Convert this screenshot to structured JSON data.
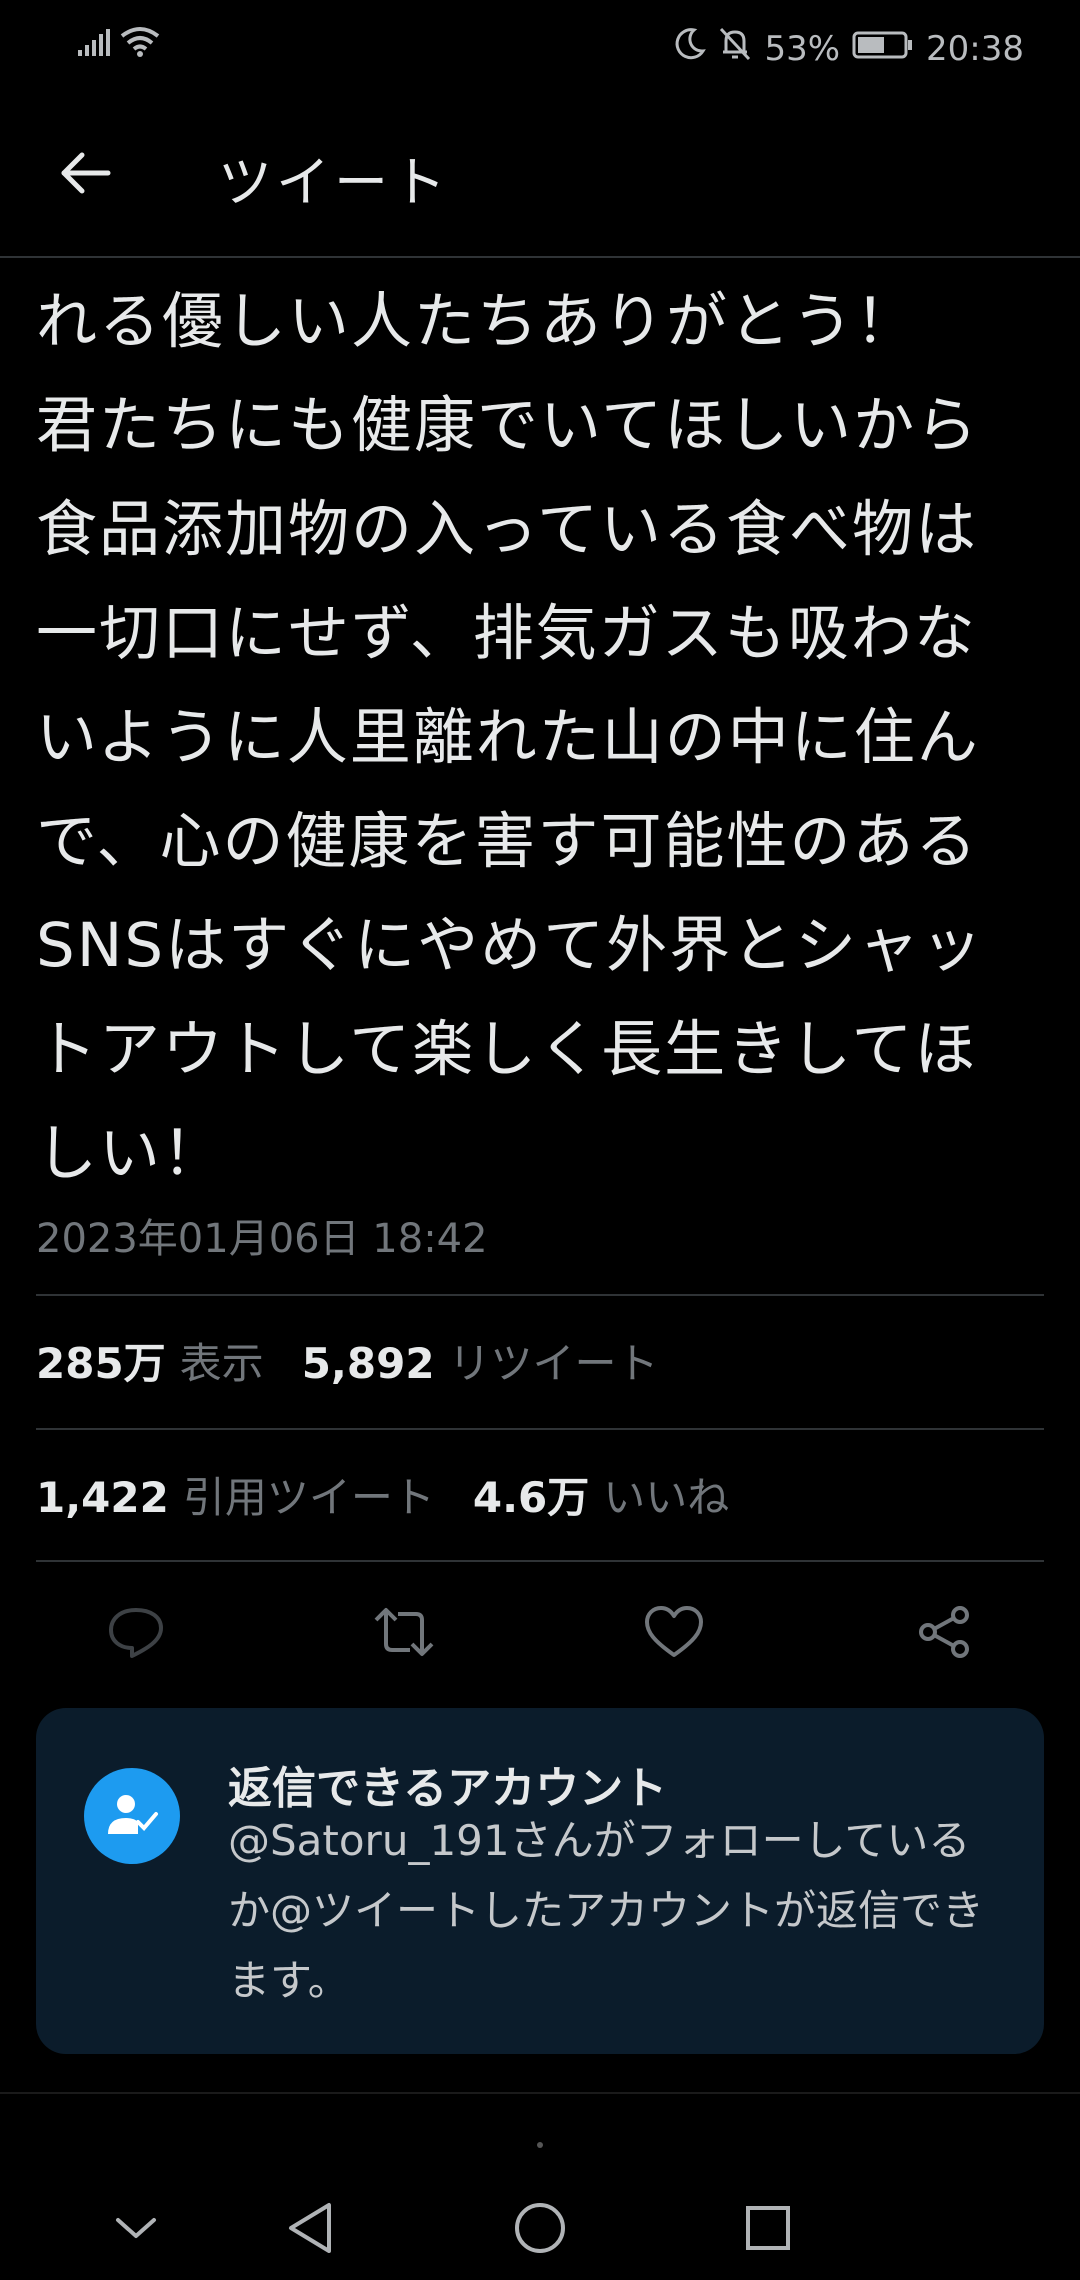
{
  "status_bar": {
    "battery_percent": "53%",
    "time": "20:38",
    "icons": [
      "signal-icon",
      "wifi-icon",
      "moon-icon",
      "bell-off-icon",
      "battery-icon"
    ]
  },
  "header": {
    "title": "ツイート",
    "back_icon": "arrow-left-icon"
  },
  "tweet": {
    "text": "れる優しい人たちありがとう！\n君たちにも健康でいてほしいから\n食品添加物の入っている食べ物は\n一切口にせず、排気ガスも吸わな\nいように人里離れた山の中に住ん\nで、心の健康を害す可能性のある\nSNSはすぐにやめて外界とシャッ\nトアウトして楽しく長生きしてほ\nしい！",
    "timestamp": "2023年01月06日 18:42"
  },
  "stats": {
    "views_num": "285万",
    "views_label": "表示",
    "retweets_num": "5,892",
    "retweets_label": "リツイート",
    "quotes_num": "1,422",
    "quotes_label": "引用ツイート",
    "likes_num": "4.6万",
    "likes_label": "いいね"
  },
  "actions": [
    "reply-icon",
    "retweet-icon",
    "like-icon",
    "share-icon"
  ],
  "reply_restriction": {
    "title": "返信できるアカウント",
    "text": "@Satoru_191さんがフォローしているか@ツイートしたアカウントが返信できます。"
  },
  "colors": {
    "background": "#000000",
    "text": "#e7e9ea",
    "muted": "#71767b",
    "accent": "#1d9bf0",
    "card_bg": "#0b1c2b"
  }
}
